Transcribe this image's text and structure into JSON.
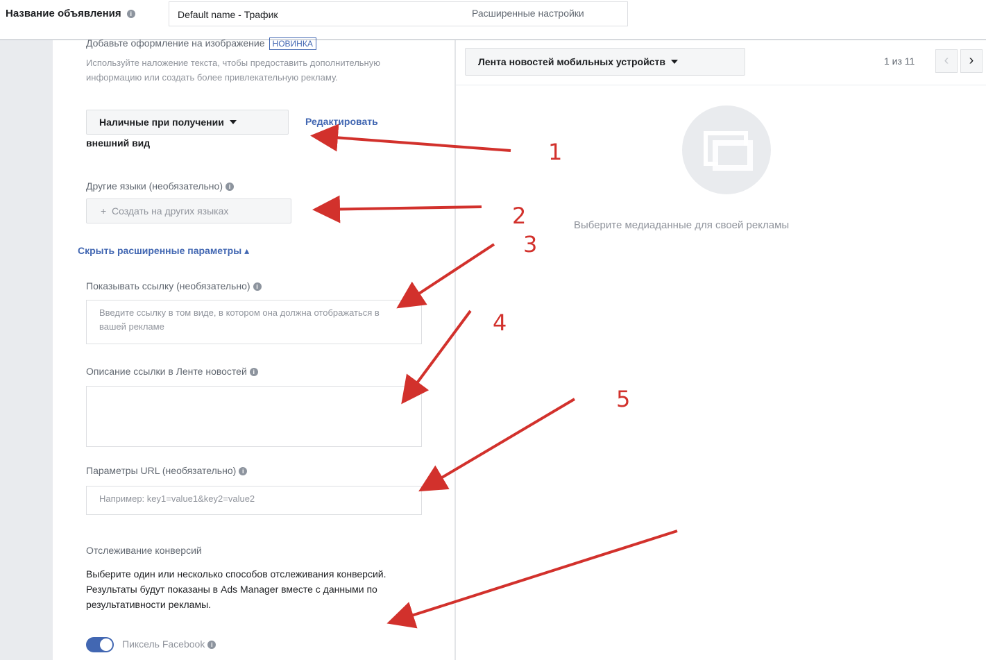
{
  "header": {
    "ad_name_label": "Название объявления",
    "ad_name_value": "Default name - Трафик",
    "advanced_settings": "Расширенные настройки"
  },
  "left": {
    "overlay_title": "Добавьте оформление на изображение",
    "overlay_badge": "НОВИНКА",
    "overlay_desc": "Используйте наложение текста, чтобы предоставить дополнительную информацию или создать более привлекательную рекламу.",
    "dropdown_value": "Наличные при получении",
    "edit_link_1": "Редактировать",
    "edit_link_2": "внешний вид",
    "other_lang_label": "Другие языки (необязательно)",
    "create_lang_button": "Создать на других языках",
    "hide_advanced": "Скрыть расширенные параметры",
    "display_link_label": "Показывать ссылку (необязательно)",
    "display_link_placeholder": "Введите ссылку в том виде, в котором она должна отображаться в вашей рекламе",
    "news_feed_link_desc_label": "Описание ссылки в Ленте новостей",
    "url_params_label": "Параметры URL (необязательно)",
    "url_params_placeholder": "Например: key1=value1&key2=value2",
    "conversion_tracking_title": "Отслеживание конверсий",
    "conversion_tracking_desc": "Выберите один или несколько способов отслеживания конверсий. Результаты будут показаны в Ads Manager вместе с данными по результативности рекламы.",
    "pixel_label": "Пиксель Facebook"
  },
  "preview": {
    "placement_dropdown": "Лента новостей мобильных устройств",
    "pager": "1 из 11",
    "empty_media_text": "Выберите медиаданные для своей рекламы"
  },
  "annotations": {
    "n1": "1",
    "n2": "2",
    "n3": "3",
    "n4": "4",
    "n5": "5"
  },
  "colors": {
    "arrow": "#d2312c",
    "link": "#4267b2",
    "rail": "#e9ebee"
  },
  "icons": [
    "info-icon",
    "caret-down-icon",
    "plus-icon",
    "chevron-left-icon",
    "chevron-right-icon",
    "media-placeholder-icon"
  ]
}
